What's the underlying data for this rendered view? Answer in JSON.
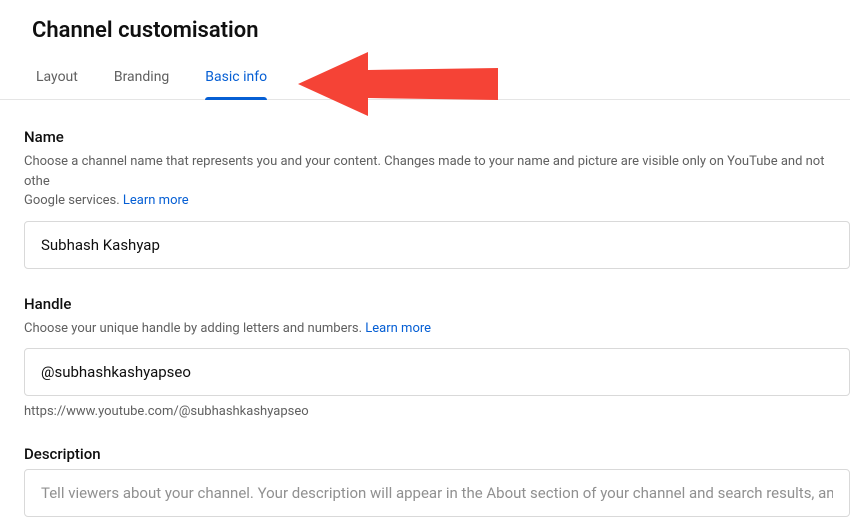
{
  "page_title": "Channel customisation",
  "tabs": [
    {
      "label": "Layout",
      "active": false
    },
    {
      "label": "Branding",
      "active": false
    },
    {
      "label": "Basic info",
      "active": true
    }
  ],
  "name_section": {
    "label": "Name",
    "desc_part1": "Choose a channel name that represents you and your content. Changes made to your name and picture are visible only on YouTube and not othe",
    "desc_part2": "Google services. ",
    "learn_more": "Learn more",
    "value": "Subhash Kashyap"
  },
  "handle_section": {
    "label": "Handle",
    "desc": "Choose your unique handle by adding letters and numbers. ",
    "learn_more": "Learn more",
    "value": "@subhashkashyapseo",
    "url": "https://www.youtube.com/@subhashkashyapseo"
  },
  "description_section": {
    "label": "Description",
    "placeholder": "Tell viewers about your channel. Your description will appear in the About section of your channel and search results, amo"
  }
}
